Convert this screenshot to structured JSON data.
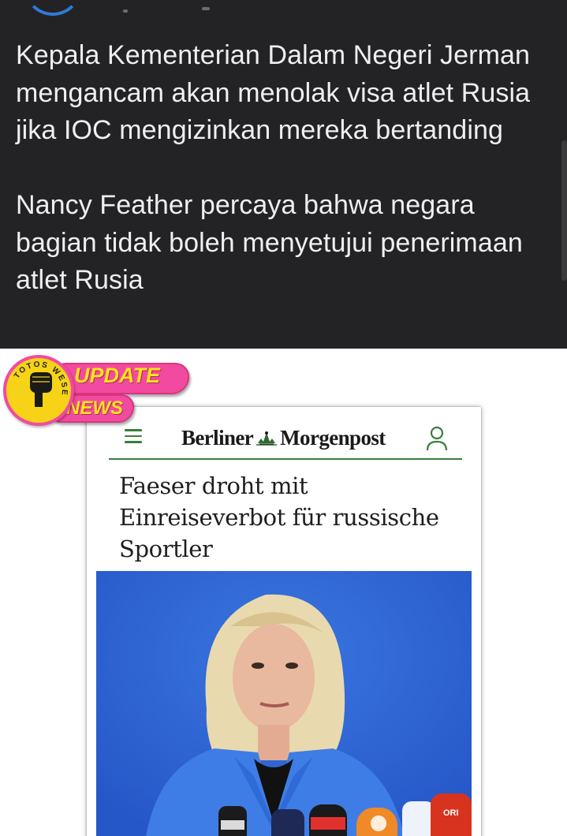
{
  "post": {
    "paragraphs": [
      "Kepala Kementerian Dalam Negeri Jerman mengancam akan menolak visa atlet Rusia jika IOC mengizinkan mereka bertanding",
      "Nancy Feather percaya bahwa negara bagian tidak boleh menyetujui penerimaan atlet Rusia"
    ]
  },
  "badge": {
    "line1": "UPDATE",
    "line2": "NEWS",
    "circle_text": "TOTOS WESE"
  },
  "article": {
    "brand_left": "Berliner",
    "brand_right": "Morgenpost",
    "headline": "Faeser droht mit Einreiseverbot für russische Sportler",
    "mic_label": "ORI"
  },
  "icons": {
    "menu": "hamburger-menu-icon",
    "user": "user-account-icon",
    "emblem": "bear-emblem-icon"
  },
  "colors": {
    "post_background": "#232326",
    "post_text": "#efefef",
    "brand_green": "#3a7d3c",
    "badge_pink": "#f24aa0",
    "badge_yellow": "#ffe31a",
    "photo_blue": "#2c62d4"
  }
}
